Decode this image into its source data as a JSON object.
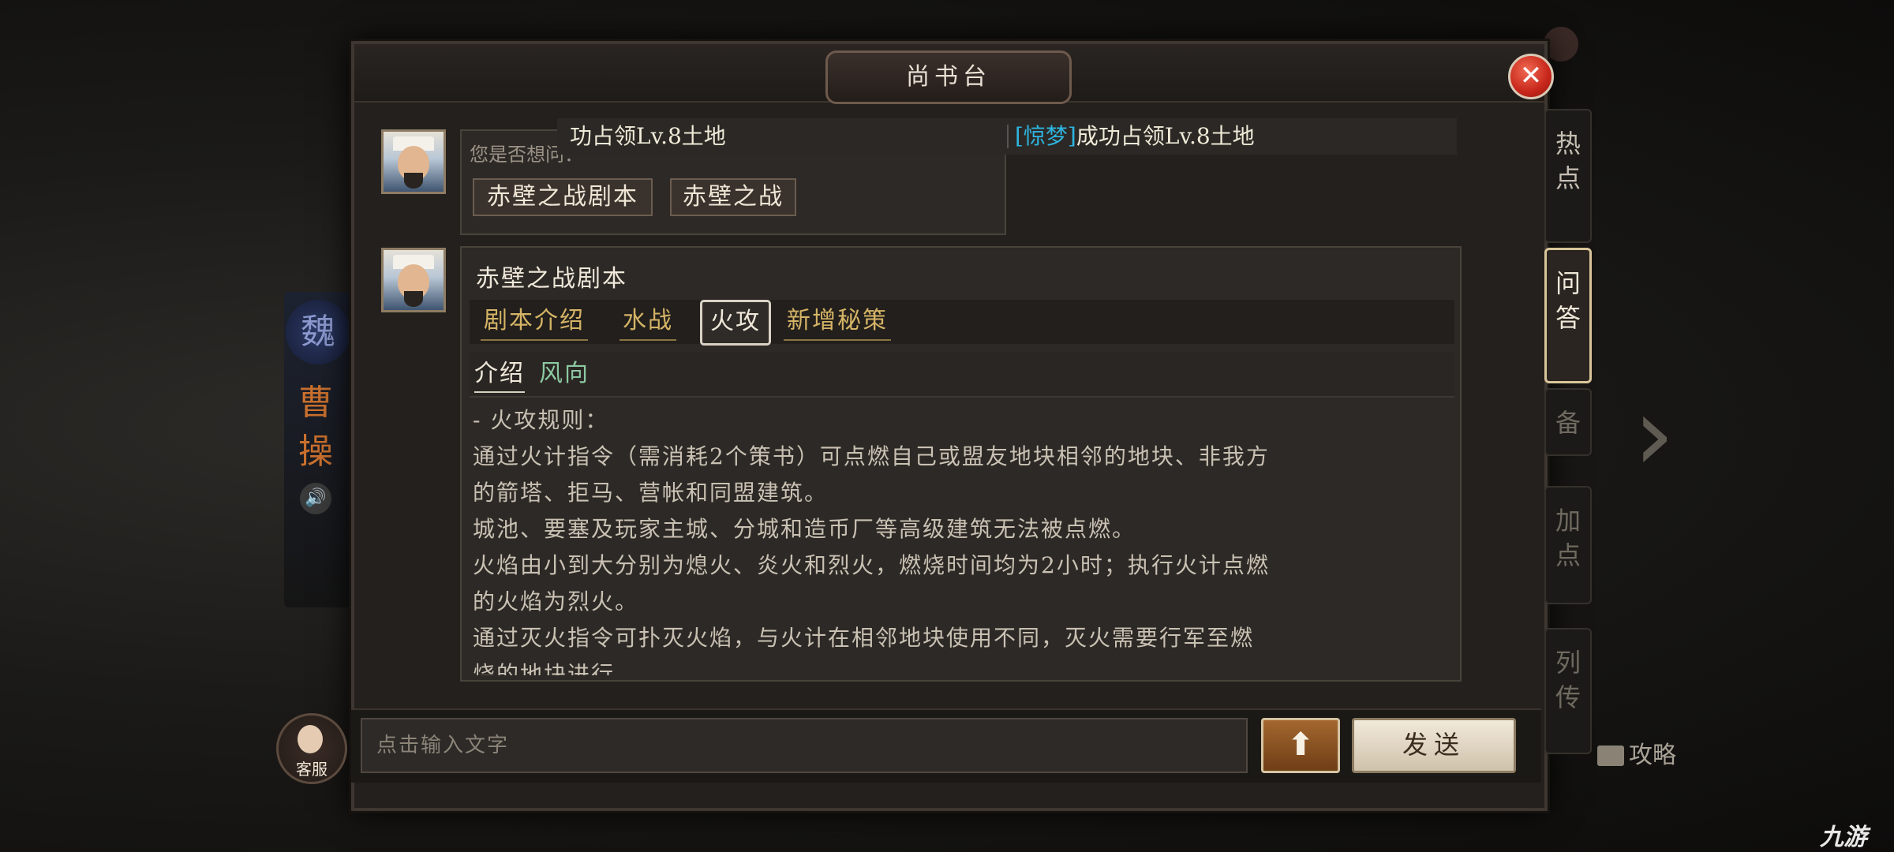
{
  "header": {
    "title": "尚书台",
    "close_glyph": "✕"
  },
  "side_tabs": [
    {
      "label": "热点",
      "active": false
    },
    {
      "label": "问答",
      "active": true
    },
    {
      "label": "备",
      "active": false
    },
    {
      "label": "加点",
      "active": false
    },
    {
      "label": "列传",
      "active": false
    }
  ],
  "notice": {
    "left_text": "功占领Lv.8土地",
    "tag": "[惊梦]",
    "right_text": "成功占领Lv.8土地"
  },
  "message1": {
    "prompt": "您是否想问：",
    "options": [
      "赤壁之战剧本",
      "赤壁之战"
    ]
  },
  "message2": {
    "title": "赤壁之战剧本",
    "tabs": [
      "剧本介绍",
      "水战",
      "火攻",
      "新增秘策"
    ],
    "active_tab": "火攻",
    "subtabs": [
      "介绍",
      "风向"
    ],
    "active_subtab": "介绍",
    "body": [
      "- 火攻规则：",
      "通过火计指令（需消耗2个策书）可点燃自己或盟友地块相邻的地块、非我方",
      "的箭塔、拒马、营帐和同盟建筑。",
      "城池、要塞及玩家主城、分城和造币厂等高级建筑无法被点燃。",
      "火焰由小到大分别为熄火、炎火和烈火，燃烧时间均为2小时；执行火计点燃",
      "的火焰为烈火。",
      "通过灭火指令可扑灭火焰，与火计在相邻地块使用不同，灭火需要行军至燃",
      "烧的地块进行"
    ]
  },
  "input": {
    "placeholder": "点击输入文字",
    "up_glyph": "⬆",
    "send_label": "发送"
  },
  "kefu": {
    "label": "客服"
  },
  "background": {
    "faction": "魏",
    "name": "曹操",
    "gonglue": "攻略",
    "watermark": "九游"
  },
  "colors": {
    "accent_gold": "#d5b466",
    "tag_blue": "#2fb4e0",
    "subtab_green": "#8cc9a2",
    "close_red": "#c7261a"
  }
}
